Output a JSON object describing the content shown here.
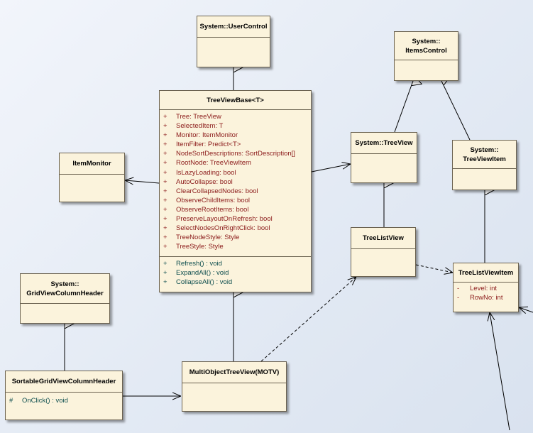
{
  "classes": {
    "user_control": {
      "name": "System::UserControl"
    },
    "items_control": {
      "name_line1": "System::",
      "name_line2": "ItemsControl"
    },
    "tree_view_base": {
      "name": "TreeViewBase<T>",
      "attributes": [
        {
          "vis": "+",
          "text": "Tree:  TreeView"
        },
        {
          "vis": "+",
          "text": "SelectedItem:  T"
        },
        {
          "vis": "+",
          "text": "Monitor:  ItemMonitor"
        },
        {
          "vis": "+",
          "text": "ItemFilter:  Predict<T>"
        },
        {
          "vis": "+",
          "text": "NodeSortDescriptions:  SortDescription[]"
        },
        {
          "vis": "+",
          "text": "RootNode:  TreeViewItem"
        },
        {
          "vis": "+",
          "text": "IsLazyLoading:  bool"
        },
        {
          "vis": "+",
          "text": "AutoCollapse:  bool"
        },
        {
          "vis": "+",
          "text": "ClearCollapsedNodes:  bool"
        },
        {
          "vis": "+",
          "text": "ObserveChildItems:  bool"
        },
        {
          "vis": "+",
          "text": "ObserveRootItems:  bool"
        },
        {
          "vis": "+",
          "text": "PreserveLayoutOnRefresh:  bool"
        },
        {
          "vis": "+",
          "text": "SelectNodesOnRightClick:  bool"
        },
        {
          "vis": "+",
          "text": "TreeNodeStyle:  Style"
        },
        {
          "vis": "+",
          "text": "TreeStyle:  Style"
        }
      ],
      "operations": [
        {
          "vis": "+",
          "text": "Refresh() : void"
        },
        {
          "vis": "+",
          "text": "ExpandAll() : void"
        },
        {
          "vis": "+",
          "text": "CollapseAll() : void"
        }
      ]
    },
    "tree_view": {
      "name": "System::TreeView"
    },
    "tree_view_item": {
      "name_line1": "System::",
      "name_line2": "TreeViewItem"
    },
    "item_monitor": {
      "name": "ItemMonitor"
    },
    "tree_list_view": {
      "name": "TreeListView"
    },
    "tree_list_view_item": {
      "name": "TreeListViewItem",
      "attributes": [
        {
          "vis": "-",
          "text": "Level:  int"
        },
        {
          "vis": "-",
          "text": "RowNo:  int"
        }
      ]
    },
    "grid_view_column_header": {
      "name_line1": "System::",
      "name_line2": "GridViewColumnHeader"
    },
    "sortable_header": {
      "name": "SortableGridViewColumnHeader",
      "operations": [
        {
          "vis": "#",
          "text": "OnClick() : void"
        }
      ]
    },
    "motv": {
      "name": "MultiObjectTreeView(MOTV)"
    }
  },
  "colors": {
    "class_fill": "#fbf3dc",
    "class_border": "#6b6250",
    "attribute_text": "#8b1a1a",
    "operation_text": "#0f4f4f",
    "connector": "#000000"
  }
}
